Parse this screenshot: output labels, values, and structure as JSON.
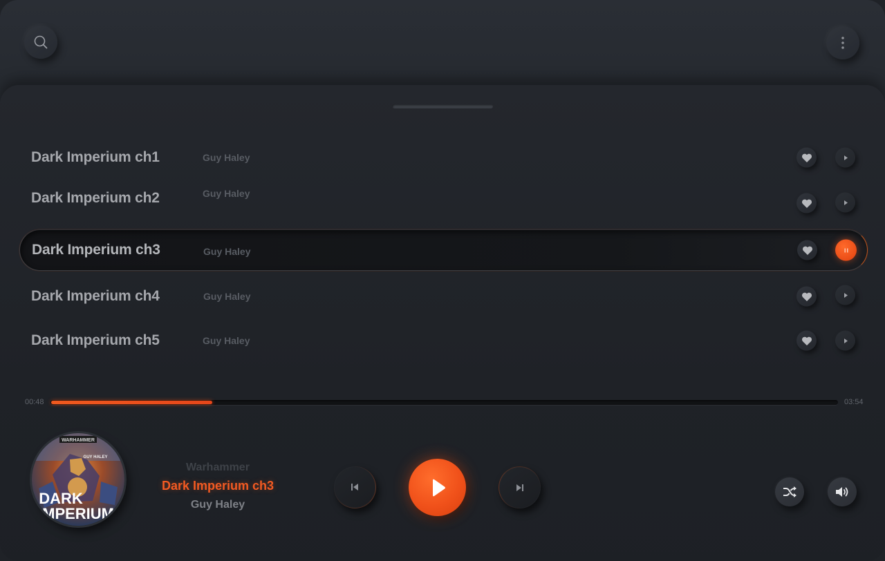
{
  "header": {
    "search_icon": "search-icon",
    "menu_icon": "more-vertical-icon"
  },
  "playlist": {
    "tracks": [
      {
        "title": "Dark Imperium ch1",
        "artist": "Guy Haley",
        "state": "idle"
      },
      {
        "title": "Dark Imperium ch2",
        "artist": "Guy Haley",
        "state": "idle"
      },
      {
        "title": "Dark Imperium ch3",
        "artist": "Guy Haley",
        "state": "playing"
      },
      {
        "title": "Dark Imperium ch4",
        "artist": "Guy Haley",
        "state": "idle"
      },
      {
        "title": "Dark Imperium ch5",
        "artist": "Guy Haley",
        "state": "idle"
      }
    ]
  },
  "progress": {
    "current": "00:48",
    "total": "03:54",
    "fraction": 0.205
  },
  "now_playing": {
    "album": "Warhammer",
    "title": "Dark Imperium ch3",
    "artist": "Guy Haley",
    "cover_text": {
      "brand": "WARHAMMER",
      "author": "GUY HALEY",
      "line1": "DARK",
      "line2": "IMPERIUM"
    }
  },
  "colors": {
    "accent": "#f0511a",
    "text": "#a6a8ad",
    "muted": "#585c63",
    "background": "#1f2227"
  }
}
